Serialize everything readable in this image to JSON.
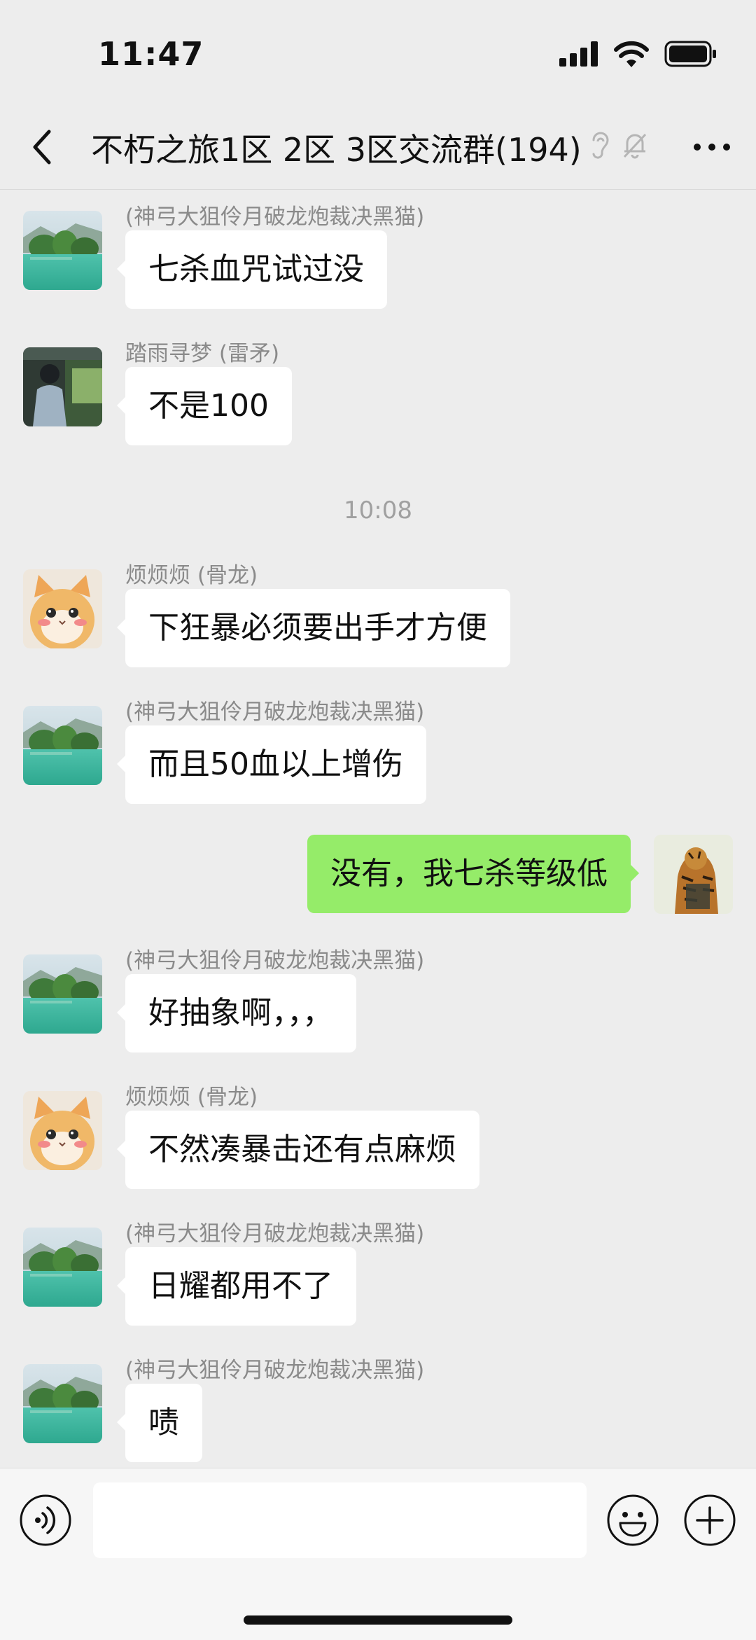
{
  "status_bar": {
    "time": "11:47"
  },
  "nav": {
    "title": "不朽之旅1区 2区 3区交流群(194)"
  },
  "messages": [
    {
      "sender": "(神弓大狙伶月破龙炮裁决黑猫)",
      "text": "七杀血咒试过没",
      "avatar": "lake-avatar"
    },
    {
      "sender": "踏雨寻梦 (雷矛)",
      "text": "不是100",
      "avatar": "person-avatar"
    },
    {
      "sender": "烦烦烦 (骨龙)",
      "text": "下狂暴必须要出手才方便",
      "avatar": "cat-avatar"
    },
    {
      "sender": "(神弓大狙伶月破龙炮裁决黑猫)",
      "text": "而且50血以上增伤",
      "avatar": "lake-avatar"
    },
    {
      "sender": "",
      "text": "没有，我七杀等级低",
      "avatar": "tiger-avatar",
      "self": true
    },
    {
      "sender": "(神弓大狙伶月破龙炮裁决黑猫)",
      "text": "好抽象啊，，，",
      "avatar": "lake-avatar"
    },
    {
      "sender": "烦烦烦 (骨龙)",
      "text": "不然凑暴击还有点麻烦",
      "avatar": "cat-avatar"
    },
    {
      "sender": "(神弓大狙伶月破龙炮裁决黑猫)",
      "text": "日耀都用不了",
      "avatar": "lake-avatar"
    },
    {
      "sender": "(神弓大狙伶月破龙炮裁决黑猫)",
      "text": "啧",
      "avatar": "lake-avatar"
    }
  ],
  "time_divider": "10:08",
  "input": {
    "placeholder": ""
  },
  "colors": {
    "background": "#ededed",
    "self_bubble": "#95ec69",
    "other_bubble": "#ffffff"
  }
}
